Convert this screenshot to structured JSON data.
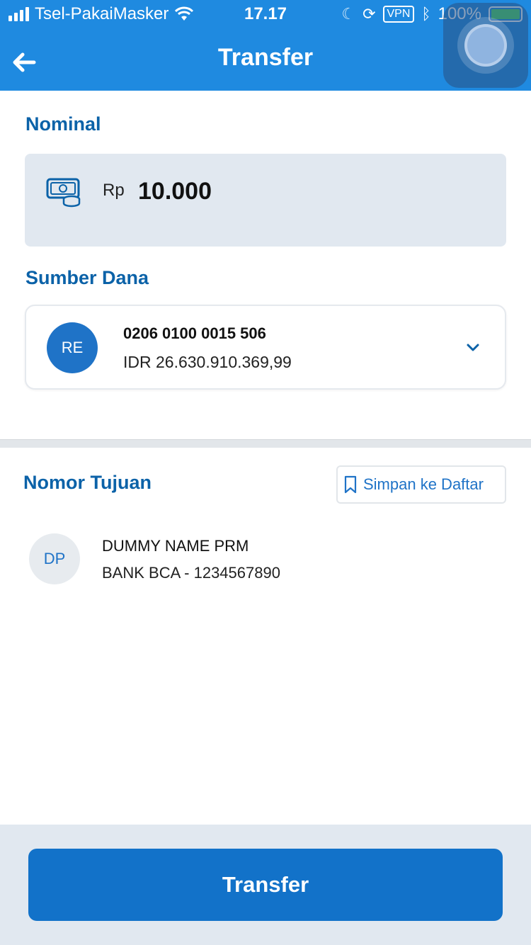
{
  "status_bar": {
    "carrier": "Tsel-PakaiMasker",
    "time": "17.17",
    "vpn": "VPN",
    "battery": "100%"
  },
  "header": {
    "title": "Transfer"
  },
  "nominal": {
    "label": "Nominal",
    "currency": "Rp",
    "amount": "10.000"
  },
  "source": {
    "label": "Sumber Dana",
    "initials": "RE",
    "account_number": "0206 0100 0015 506",
    "balance": "IDR 26.630.910.369,99"
  },
  "destination": {
    "label": "Nomor Tujuan",
    "save_label": "Simpan ke Daftar",
    "initials": "DP",
    "name": "DUMMY NAME PRM",
    "bank": "BANK BCA - 1234567890"
  },
  "footer": {
    "transfer_label": "Transfer"
  },
  "colors": {
    "primary": "#1f8ae0",
    "button": "#1272c9",
    "accent_text": "#0b62a8"
  }
}
